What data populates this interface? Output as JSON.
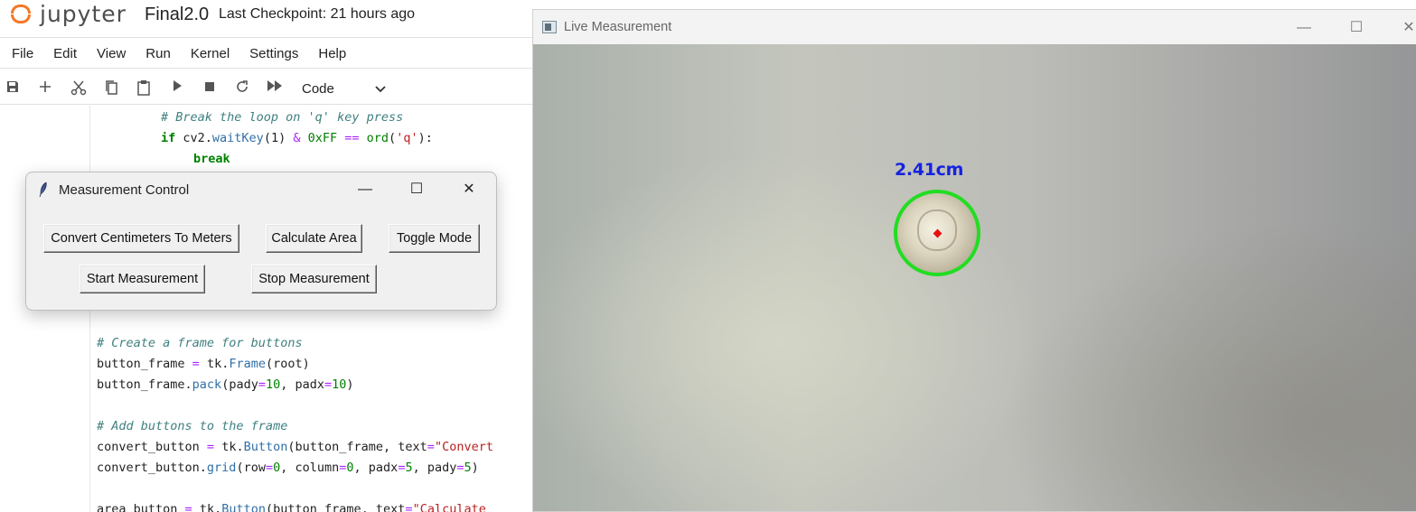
{
  "jupyter": {
    "logo_text": "jupyter",
    "notebook_name": "Final2.0",
    "checkpoint": "Last Checkpoint: 21 hours ago",
    "menu": [
      "File",
      "Edit",
      "View",
      "Run",
      "Kernel",
      "Settings",
      "Help"
    ],
    "toolbar": {
      "icons": [
        "save-icon",
        "add-cell-icon",
        "cut-icon",
        "copy-icon",
        "paste-icon",
        "run-icon",
        "stop-icon",
        "restart-icon",
        "fast-forward-icon"
      ],
      "cell_type": "Code"
    },
    "code_top": {
      "comment_break": "# Break the loop on 'q' key press",
      "if_kw": "if",
      "if_pre": " cv2.",
      "waitkey": "waitKey",
      "if_args": "(1) ",
      "amp": "&",
      "hex": " 0xFF ",
      "eqeq": "==",
      "ord_pre": " ",
      "ord": "ord",
      "ord_arg_open": "(",
      "ord_q": "'q'",
      "ord_close": "):",
      "break_kw": "break"
    },
    "code_bottom": {
      "comment_frame": "# Create a frame for buttons",
      "l1_a": "button_frame ",
      "l1_eq": "=",
      "l1_b": " tk.",
      "l1_fn": "Frame",
      "l1_c": "(root)",
      "l2_a": "button_frame.",
      "l2_fn": "pack",
      "l2_b": "(pady",
      "l2_eq1": "=",
      "l2_n1": "10",
      "l2_c": ", padx",
      "l2_eq2": "=",
      "l2_n2": "10",
      "l2_d": ")",
      "comment_add": "# Add buttons to the frame",
      "l3_a": "convert_button ",
      "l3_eq": "=",
      "l3_b": " tk.",
      "l3_fn": "Button",
      "l3_c": "(button_frame, text",
      "l3_eq2": "=",
      "l3_str": "\"Convert",
      "l4_a": "convert_button.",
      "l4_fn": "grid",
      "l4_b": "(row",
      "l4_eq1": "=",
      "l4_n1": "0",
      "l4_c": ", column",
      "l4_eq2": "=",
      "l4_n2": "0",
      "l4_d": ", padx",
      "l4_eq3": "=",
      "l4_n3": "5",
      "l4_e": ", pady",
      "l4_eq4": "=",
      "l4_n4": "5",
      "l4_f": ")",
      "l5_a": "area_button ",
      "l5_eq": "=",
      "l5_b": " tk.",
      "l5_fn": "Button",
      "l5_c": "(button_frame, text",
      "l5_eq2": "=",
      "l5_str": "\"Calculate"
    }
  },
  "tk_window": {
    "title": "Measurement Control",
    "controls": {
      "minimize": "—",
      "maximize": "☐",
      "close": "✕"
    },
    "buttons": {
      "convert": "Convert Centimeters To Meters",
      "area": "Calculate Area",
      "toggle": "Toggle Mode",
      "start": "Start Measurement",
      "stop": "Stop Measurement"
    }
  },
  "live_window": {
    "title": "Live Measurement",
    "controls": {
      "minimize": "—",
      "maximize": "☐",
      "close": "✕"
    },
    "measurement_label": "2.41cm",
    "colors": {
      "label": "#1522e0",
      "circle": "#22dd22",
      "center": "#e81010"
    }
  }
}
